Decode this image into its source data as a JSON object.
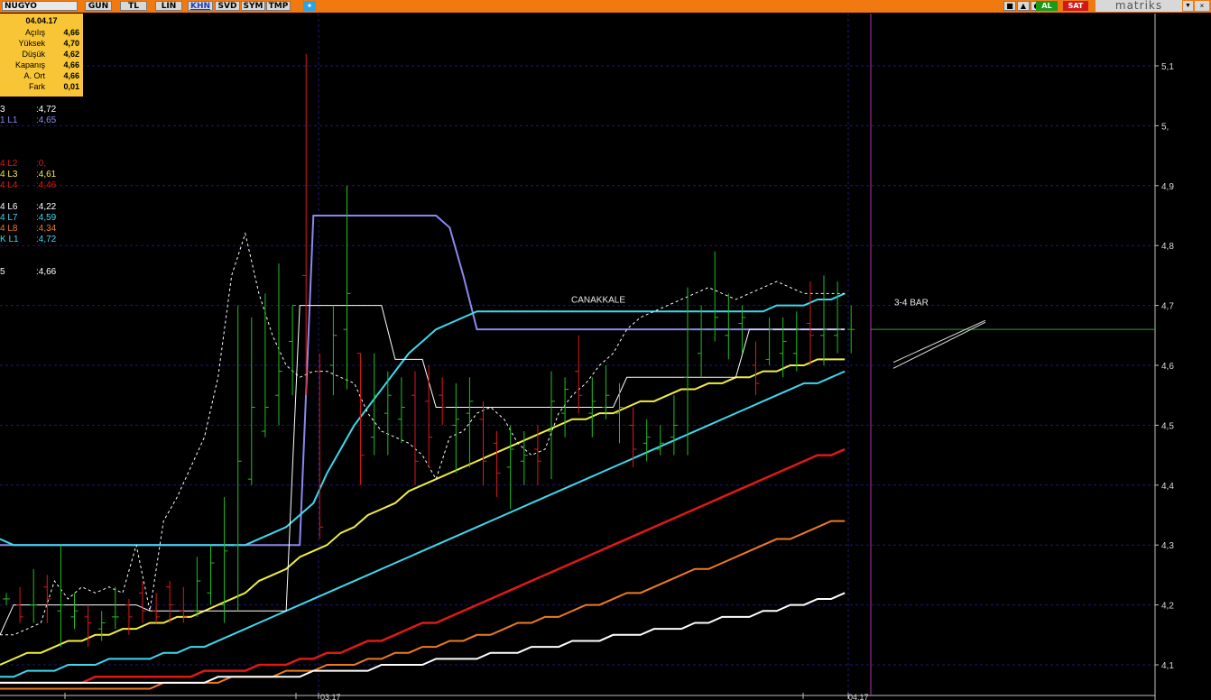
{
  "toolbar": {
    "symbol": "NUGYO",
    "period_buttons": [
      "GUN",
      "TL",
      "LIN",
      "KHN",
      "SVD",
      "SYM",
      "TMP"
    ],
    "active_button": "KHN",
    "buy_label": "AL",
    "sell_label": "SAT",
    "brand": "matriks",
    "colors": {
      "bar": "#f07a10",
      "buy": "#1a9a1a",
      "sell": "#d01818"
    }
  },
  "info_panel": {
    "date": "04.04.17",
    "rows": [
      {
        "label": "Açılış",
        "value": "4,66"
      },
      {
        "label": "Yüksek",
        "value": "4,70"
      },
      {
        "label": "Düşük",
        "value": "4,62"
      },
      {
        "label": "Kapanış",
        "value": "4,66"
      },
      {
        "label": "A. Ort",
        "value": "4,66"
      },
      {
        "label": "Fark",
        "value": "0,01"
      }
    ],
    "background": "#f7c535"
  },
  "legend": [
    {
      "name": "3",
      "value": ":4,72",
      "color": "#ffffff"
    },
    {
      "name": "1 L1",
      "value": ":4,65",
      "color": "#8a88f0"
    },
    {
      "name": "4 L2",
      "value": ":0,",
      "color": "#e01818"
    },
    {
      "name": "4 L3",
      "value": ":4,61",
      "color": "#f2ee40"
    },
    {
      "name": "4 L4",
      "value": ":4,46",
      "color": "#e01818"
    },
    {
      "name": "4 L6",
      "value": ":4,22",
      "color": "#ffffff"
    },
    {
      "name": "4 L7",
      "value": ":4,59",
      "color": "#3fd8ee"
    },
    {
      "name": "4 L8",
      "value": ":4,34",
      "color": "#f07a22"
    },
    {
      "name": "K L1",
      "value": ":4,72",
      "color": "#3fd8ee"
    },
    {
      "name": "5",
      "value": ":4,66",
      "color": "#ffffff"
    }
  ],
  "annotations": {
    "canakkale": "CANAKKALE",
    "bars": "3-4 BAR"
  },
  "chart_data": {
    "type": "bar",
    "yaxis_ticks": [
      "5,1",
      "5,",
      "4,9",
      "4,8",
      "4,7",
      "4,6",
      "4,5",
      "4,4",
      "4,3",
      "4,2",
      "4,1"
    ],
    "ylim": [
      4.08,
      5.18
    ],
    "xaxis_labels": [
      "03.17",
      "04.17"
    ],
    "grid": true,
    "candles": [
      {
        "o": 4.21,
        "h": 4.22,
        "l": 4.2,
        "c": 4.21
      },
      {
        "o": 4.2,
        "h": 4.23,
        "l": 4.17,
        "c": 4.18
      },
      {
        "o": 4.2,
        "h": 4.26,
        "l": 4.17,
        "c": 4.2
      },
      {
        "o": 4.23,
        "h": 4.25,
        "l": 4.17,
        "c": 4.21
      },
      {
        "o": 4.19,
        "h": 4.3,
        "l": 4.13,
        "c": 4.2
      },
      {
        "o": 4.18,
        "h": 4.22,
        "l": 4.16,
        "c": 4.19
      },
      {
        "o": 4.18,
        "h": 4.2,
        "l": 4.13,
        "c": 4.17
      },
      {
        "o": 4.16,
        "h": 4.19,
        "l": 4.14,
        "c": 4.17
      },
      {
        "o": 4.18,
        "h": 4.23,
        "l": 4.16,
        "c": 4.18
      },
      {
        "o": 4.2,
        "h": 4.21,
        "l": 4.15,
        "c": 4.18
      },
      {
        "o": 4.22,
        "h": 4.24,
        "l": 4.17,
        "c": 4.19
      },
      {
        "o": 4.19,
        "h": 4.22,
        "l": 4.17,
        "c": 4.18
      },
      {
        "o": 4.23,
        "h": 4.24,
        "l": 4.17,
        "c": 4.2
      },
      {
        "o": 4.19,
        "h": 4.23,
        "l": 4.17,
        "c": 4.18
      },
      {
        "o": 4.19,
        "h": 4.28,
        "l": 4.18,
        "c": 4.24
      },
      {
        "o": 4.22,
        "h": 4.3,
        "l": 4.2,
        "c": 4.27
      },
      {
        "o": 4.2,
        "h": 4.38,
        "l": 4.17,
        "c": 4.29
      },
      {
        "o": 4.3,
        "h": 4.7,
        "l": 4.19,
        "c": 4.44
      },
      {
        "o": 4.41,
        "h": 4.68,
        "l": 4.4,
        "c": 4.53
      },
      {
        "o": 4.49,
        "h": 4.72,
        "l": 4.48,
        "c": 4.53
      },
      {
        "o": 4.55,
        "h": 4.77,
        "l": 4.5,
        "c": 4.59
      },
      {
        "o": 4.64,
        "h": 4.7,
        "l": 4.55,
        "c": 4.7
      },
      {
        "o": 4.75,
        "h": 5.12,
        "l": 4.55,
        "c": 4.59
      },
      {
        "o": 4.59,
        "h": 4.62,
        "l": 4.31,
        "c": 4.33
      },
      {
        "o": 4.6,
        "h": 4.7,
        "l": 4.55,
        "c": 4.65
      },
      {
        "o": 4.66,
        "h": 4.9,
        "l": 4.56,
        "c": 4.72
      },
      {
        "o": 4.62,
        "h": 4.62,
        "l": 4.4,
        "c": 4.45
      },
      {
        "o": 4.48,
        "h": 4.62,
        "l": 4.45,
        "c": 4.55
      },
      {
        "o": 4.52,
        "h": 4.59,
        "l": 4.45,
        "c": 4.55
      },
      {
        "o": 4.51,
        "h": 4.58,
        "l": 4.47,
        "c": 4.53
      },
      {
        "o": 4.55,
        "h": 4.59,
        "l": 4.4,
        "c": 4.44
      },
      {
        "o": 4.54,
        "h": 4.6,
        "l": 4.43,
        "c": 4.48
      },
      {
        "o": 4.55,
        "h": 4.58,
        "l": 4.5,
        "c": 4.53
      },
      {
        "o": 4.5,
        "h": 4.57,
        "l": 4.42,
        "c": 4.51
      },
      {
        "o": 4.52,
        "h": 4.58,
        "l": 4.43,
        "c": 4.54
      },
      {
        "o": 4.51,
        "h": 4.54,
        "l": 4.4,
        "c": 4.44
      },
      {
        "o": 4.47,
        "h": 4.49,
        "l": 4.38,
        "c": 4.42
      },
      {
        "o": 4.43,
        "h": 4.5,
        "l": 4.36,
        "c": 4.46
      },
      {
        "o": 4.44,
        "h": 4.49,
        "l": 4.4,
        "c": 4.45
      },
      {
        "o": 4.46,
        "h": 4.5,
        "l": 4.4,
        "c": 4.44
      },
      {
        "o": 4.49,
        "h": 4.59,
        "l": 4.41,
        "c": 4.54
      },
      {
        "o": 4.52,
        "h": 4.58,
        "l": 4.48,
        "c": 4.56
      },
      {
        "o": 4.59,
        "h": 4.65,
        "l": 4.52,
        "c": 4.55
      },
      {
        "o": 4.52,
        "h": 4.58,
        "l": 4.48,
        "c": 4.54
      },
      {
        "o": 4.53,
        "h": 4.6,
        "l": 4.51,
        "c": 4.55
      },
      {
        "o": 4.52,
        "h": 4.57,
        "l": 4.47,
        "c": 4.53
      },
      {
        "o": 4.5,
        "h": 4.53,
        "l": 4.43,
        "c": 4.46
      },
      {
        "o": 4.47,
        "h": 4.51,
        "l": 4.44,
        "c": 4.48
      },
      {
        "o": 4.46,
        "h": 4.5,
        "l": 4.45,
        "c": 4.47
      },
      {
        "o": 4.48,
        "h": 4.55,
        "l": 4.45,
        "c": 4.5
      },
      {
        "o": 4.58,
        "h": 4.73,
        "l": 4.45,
        "c": 4.66
      },
      {
        "o": 4.62,
        "h": 4.7,
        "l": 4.58,
        "c": 4.66
      },
      {
        "o": 4.66,
        "h": 4.79,
        "l": 4.64,
        "c": 4.68
      },
      {
        "o": 4.65,
        "h": 4.72,
        "l": 4.61,
        "c": 4.66
      },
      {
        "o": 4.67,
        "h": 4.7,
        "l": 4.62,
        "c": 4.68
      },
      {
        "o": 4.6,
        "h": 4.64,
        "l": 4.55,
        "c": 4.57
      },
      {
        "o": 4.61,
        "h": 4.68,
        "l": 4.6,
        "c": 4.66
      },
      {
        "o": 4.62,
        "h": 4.68,
        "l": 4.58,
        "c": 4.64
      },
      {
        "o": 4.62,
        "h": 4.69,
        "l": 4.59,
        "c": 4.66
      },
      {
        "o": 4.67,
        "h": 4.74,
        "l": 4.6,
        "c": 4.65
      },
      {
        "o": 4.65,
        "h": 4.75,
        "l": 4.6,
        "c": 4.66
      },
      {
        "o": 4.65,
        "h": 4.74,
        "l": 4.62,
        "c": 4.66
      },
      {
        "o": 4.66,
        "h": 4.7,
        "l": 4.62,
        "c": 4.66
      }
    ],
    "series": [
      {
        "values": [
          4.3,
          4.3,
          4.3,
          4.3,
          4.3,
          4.3,
          4.3,
          4.3,
          4.3,
          4.3,
          4.3,
          4.3,
          4.3,
          4.3,
          4.3,
          4.3,
          4.3,
          4.3,
          4.3,
          4.3,
          4.3,
          4.3,
          4.3,
          4.85,
          4.85,
          4.85,
          4.85,
          4.85,
          4.85,
          4.85,
          4.85,
          4.85,
          4.85,
          4.83,
          4.75,
          4.66,
          4.66,
          4.66,
          4.66,
          4.66,
          4.66,
          4.66,
          4.66,
          4.66,
          4.66,
          4.66,
          4.66,
          4.66,
          4.66,
          4.66,
          4.66,
          4.66,
          4.66,
          4.66,
          4.66,
          4.66,
          4.66,
          4.66,
          4.66,
          4.66,
          4.66,
          4.66,
          4.66
        ]
      },
      {
        "values": [
          4.31,
          4.3,
          4.3,
          4.3,
          4.3,
          4.3,
          4.3,
          4.3,
          4.3,
          4.3,
          4.3,
          4.3,
          4.3,
          4.3,
          4.3,
          4.3,
          4.3,
          4.3,
          4.3,
          4.31,
          4.32,
          4.33,
          4.35,
          4.37,
          4.42,
          4.46,
          4.5,
          4.53,
          4.56,
          4.59,
          4.62,
          4.64,
          4.66,
          4.67,
          4.68,
          4.69,
          4.69,
          4.69,
          4.69,
          4.69,
          4.69,
          4.69,
          4.69,
          4.69,
          4.69,
          4.69,
          4.69,
          4.69,
          4.69,
          4.69,
          4.69,
          4.69,
          4.69,
          4.69,
          4.69,
          4.69,
          4.69,
          4.7,
          4.7,
          4.7,
          4.71,
          4.71,
          4.72
        ]
      },
      {
        "values": [
          4.1,
          4.11,
          4.12,
          4.12,
          4.13,
          4.14,
          4.14,
          4.15,
          4.15,
          4.16,
          4.16,
          4.17,
          4.17,
          4.18,
          4.18,
          4.19,
          4.2,
          4.21,
          4.22,
          4.24,
          4.25,
          4.26,
          4.28,
          4.29,
          4.3,
          4.32,
          4.33,
          4.35,
          4.36,
          4.37,
          4.39,
          4.4,
          4.41,
          4.42,
          4.43,
          4.44,
          4.45,
          4.46,
          4.47,
          4.48,
          4.49,
          4.5,
          4.51,
          4.51,
          4.52,
          4.52,
          4.53,
          4.54,
          4.54,
          4.55,
          4.56,
          4.56,
          4.57,
          4.57,
          4.58,
          4.58,
          4.59,
          4.59,
          4.6,
          4.6,
          4.61,
          4.61,
          4.61
        ]
      },
      {
        "values": [
          4.08,
          4.08,
          4.09,
          4.09,
          4.09,
          4.1,
          4.1,
          4.1,
          4.11,
          4.11,
          4.11,
          4.11,
          4.12,
          4.12,
          4.13,
          4.13,
          4.14,
          4.15,
          4.16,
          4.17,
          4.18,
          4.19,
          4.2,
          4.21,
          4.22,
          4.23,
          4.24,
          4.25,
          4.26,
          4.27,
          4.28,
          4.29,
          4.3,
          4.31,
          4.32,
          4.33,
          4.34,
          4.35,
          4.36,
          4.37,
          4.38,
          4.39,
          4.4,
          4.41,
          4.42,
          4.43,
          4.44,
          4.45,
          4.46,
          4.47,
          4.48,
          4.49,
          4.5,
          4.51,
          4.52,
          4.53,
          4.54,
          4.55,
          4.56,
          4.57,
          4.57,
          4.58,
          4.59
        ]
      },
      {
        "values": [
          4.07,
          4.07,
          4.07,
          4.07,
          4.07,
          4.07,
          4.07,
          4.08,
          4.08,
          4.08,
          4.08,
          4.08,
          4.08,
          4.08,
          4.08,
          4.09,
          4.09,
          4.09,
          4.09,
          4.1,
          4.1,
          4.1,
          4.11,
          4.11,
          4.12,
          4.12,
          4.13,
          4.14,
          4.14,
          4.15,
          4.16,
          4.17,
          4.17,
          4.18,
          4.19,
          4.2,
          4.21,
          4.22,
          4.23,
          4.24,
          4.25,
          4.26,
          4.27,
          4.28,
          4.29,
          4.3,
          4.31,
          4.32,
          4.33,
          4.34,
          4.35,
          4.36,
          4.37,
          4.38,
          4.39,
          4.4,
          4.41,
          4.42,
          4.43,
          4.44,
          4.45,
          4.45,
          4.46
        ]
      },
      {
        "values": [
          4.06,
          4.06,
          4.06,
          4.06,
          4.06,
          4.06,
          4.06,
          4.06,
          4.06,
          4.06,
          4.06,
          4.06,
          4.07,
          4.07,
          4.07,
          4.07,
          4.07,
          4.08,
          4.08,
          4.08,
          4.08,
          4.09,
          4.09,
          4.09,
          4.1,
          4.1,
          4.1,
          4.11,
          4.11,
          4.12,
          4.12,
          4.13,
          4.13,
          4.14,
          4.14,
          4.15,
          4.15,
          4.16,
          4.17,
          4.17,
          4.18,
          4.18,
          4.19,
          4.2,
          4.2,
          4.21,
          4.22,
          4.22,
          4.23,
          4.24,
          4.25,
          4.26,
          4.26,
          4.27,
          4.28,
          4.29,
          4.3,
          4.31,
          4.31,
          4.32,
          4.33,
          4.34,
          4.34
        ]
      },
      {
        "values": [
          4.07,
          4.07,
          4.07,
          4.07,
          4.07,
          4.07,
          4.07,
          4.07,
          4.07,
          4.07,
          4.07,
          4.07,
          4.07,
          4.07,
          4.07,
          4.07,
          4.08,
          4.08,
          4.08,
          4.08,
          4.08,
          4.08,
          4.08,
          4.09,
          4.09,
          4.09,
          4.09,
          4.09,
          4.1,
          4.1,
          4.1,
          4.1,
          4.11,
          4.11,
          4.11,
          4.11,
          4.12,
          4.12,
          4.12,
          4.13,
          4.13,
          4.13,
          4.14,
          4.14,
          4.14,
          4.15,
          4.15,
          4.15,
          4.16,
          4.16,
          4.16,
          4.17,
          4.17,
          4.18,
          4.18,
          4.18,
          4.19,
          4.19,
          4.2,
          4.2,
          4.21,
          4.21,
          4.22
        ]
      },
      {
        "values": [
          4.15,
          4.2,
          4.2,
          4.2,
          4.2,
          4.2,
          4.2,
          4.2,
          4.2,
          4.2,
          4.2,
          4.19,
          4.19,
          4.19,
          4.19,
          4.19,
          4.19,
          4.19,
          4.19,
          4.19,
          4.19,
          4.19,
          4.7,
          4.7,
          4.7,
          4.7,
          4.7,
          4.7,
          4.7,
          4.61,
          4.61,
          4.61,
          4.53,
          4.53,
          4.53,
          4.53,
          4.53,
          4.53,
          4.53,
          4.53,
          4.53,
          4.53,
          4.53,
          4.53,
          4.53,
          4.53,
          4.58,
          4.58,
          4.58,
          4.58,
          4.58,
          4.58,
          4.58,
          4.58,
          4.58,
          4.66,
          4.66,
          4.66,
          4.66,
          4.66,
          4.66,
          4.66,
          4.66
        ]
      },
      {
        "values": [
          4.15,
          4.15,
          4.16,
          4.17,
          4.24,
          4.21,
          4.23,
          4.22,
          4.23,
          4.22,
          4.3,
          4.19,
          4.34,
          4.38,
          4.43,
          4.48,
          4.58,
          4.75,
          4.82,
          4.72,
          4.65,
          4.6,
          4.58,
          4.59,
          4.59,
          4.58,
          4.57,
          4.52,
          4.49,
          4.48,
          4.47,
          4.45,
          4.41,
          4.48,
          4.49,
          4.52,
          4.53,
          4.51,
          4.47,
          4.45,
          4.46,
          4.52,
          4.55,
          4.57,
          4.6,
          4.62,
          4.66,
          4.68,
          4.69,
          4.7,
          4.71,
          4.72,
          4.73,
          4.72,
          4.71,
          4.72,
          4.73,
          4.74,
          4.73,
          4.72,
          4.72,
          4.72,
          4.72
        ]
      }
    ]
  }
}
